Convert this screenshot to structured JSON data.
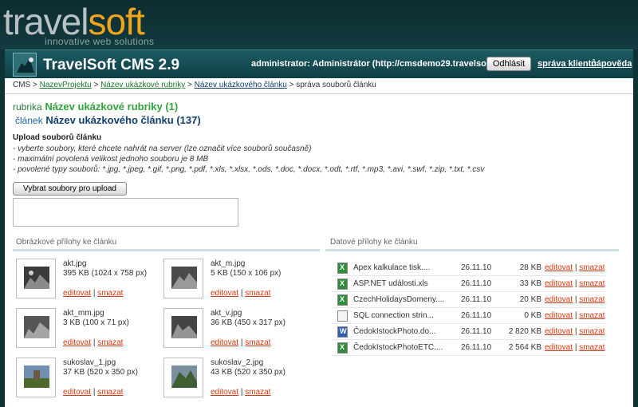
{
  "logo": {
    "part1": "travel",
    "part2": "soft",
    "tagline": "innovative web solutions"
  },
  "header": {
    "title": "TravelSoft CMS 2.9",
    "user_info": "administrator: Administrátor (http://cmsdemo29.travelsoft.cz)",
    "logout_label": "Odhlásit",
    "link_clients": "správa klientů",
    "link_help": "nápověda"
  },
  "breadcrumb": {
    "root": "CMS",
    "sep": ">",
    "project": "NazevProjektu",
    "category": "Název ukázkové rubriky",
    "article": "Název ukázkového článku",
    "current": "správa souborů článku"
  },
  "rubrika": {
    "label": "rubrika",
    "value": "Název ukázkové rubriky (1)"
  },
  "clanek": {
    "label": "článek",
    "value": "Název ukázkového článku (137)"
  },
  "upload": {
    "title": "Upload souborů článku",
    "hints": [
      "- vyberte soubory, které chcete nahrát na server (lze označit více souborů současně)",
      "- maximální povolená velikost jednoho souboru je 8 MB",
      "- povolené typy souborů: *.jpg, *.jpeg, *.gif, *.png, *.pdf, *.xls, *.xlsx, *.ods, *.doc, *.docx, *.odt, *.rtf, *.mp3, *.avi, *.swf, *.zip, *.txt, *.csv"
    ],
    "button_label": "Vybrat soubory pro upload"
  },
  "images_section": {
    "title": "Obrázkové přílohy ke článku",
    "edit_label": "editovat",
    "delete_label": "smazat",
    "sep": "|",
    "items": [
      {
        "name": "akt.jpg",
        "size": "395 KB (1024 x 758 px)"
      },
      {
        "name": "akt_m.jpg",
        "size": "5 KB (150 x 106 px)"
      },
      {
        "name": "akt_mm.jpg",
        "size": "3 KB (100 x 71 px)"
      },
      {
        "name": "akt_v.jpg",
        "size": "36 KB (450 x 317 px)"
      },
      {
        "name": "sukoslav_1.jpg",
        "size": "37 KB (520 x 350 px)"
      },
      {
        "name": "sukoslav_2.jpg",
        "size": "43 KB (520 x 350 px)"
      }
    ]
  },
  "files_section": {
    "title": "Datové přílohy ke článku",
    "edit_label": "editovat",
    "delete_label": "smazat",
    "sep": "|",
    "items": [
      {
        "icon": "excel-icon",
        "name": "Apex kalkulace tisk....",
        "date": "26.11.10",
        "size": "28 KB"
      },
      {
        "icon": "excel-icon",
        "name": "ASP.NET události.xls",
        "date": "26.11.10",
        "size": "33 KB"
      },
      {
        "icon": "excel-icon",
        "name": "CzechHolidaysDomeny....",
        "date": "26.11.10",
        "size": "20 KB"
      },
      {
        "icon": "generic-file-icon",
        "name": "SQL connection strin...",
        "date": "26.11.10",
        "size": "0 KB"
      },
      {
        "icon": "word-icon",
        "name": "ČedokIstockPhoto.do...",
        "date": "26.11.10",
        "size": "2 820 KB"
      },
      {
        "icon": "excel-icon",
        "name": "ČedokIstockPhotoETC....",
        "date": "26.11.10",
        "size": "2 564 KB"
      }
    ]
  }
}
